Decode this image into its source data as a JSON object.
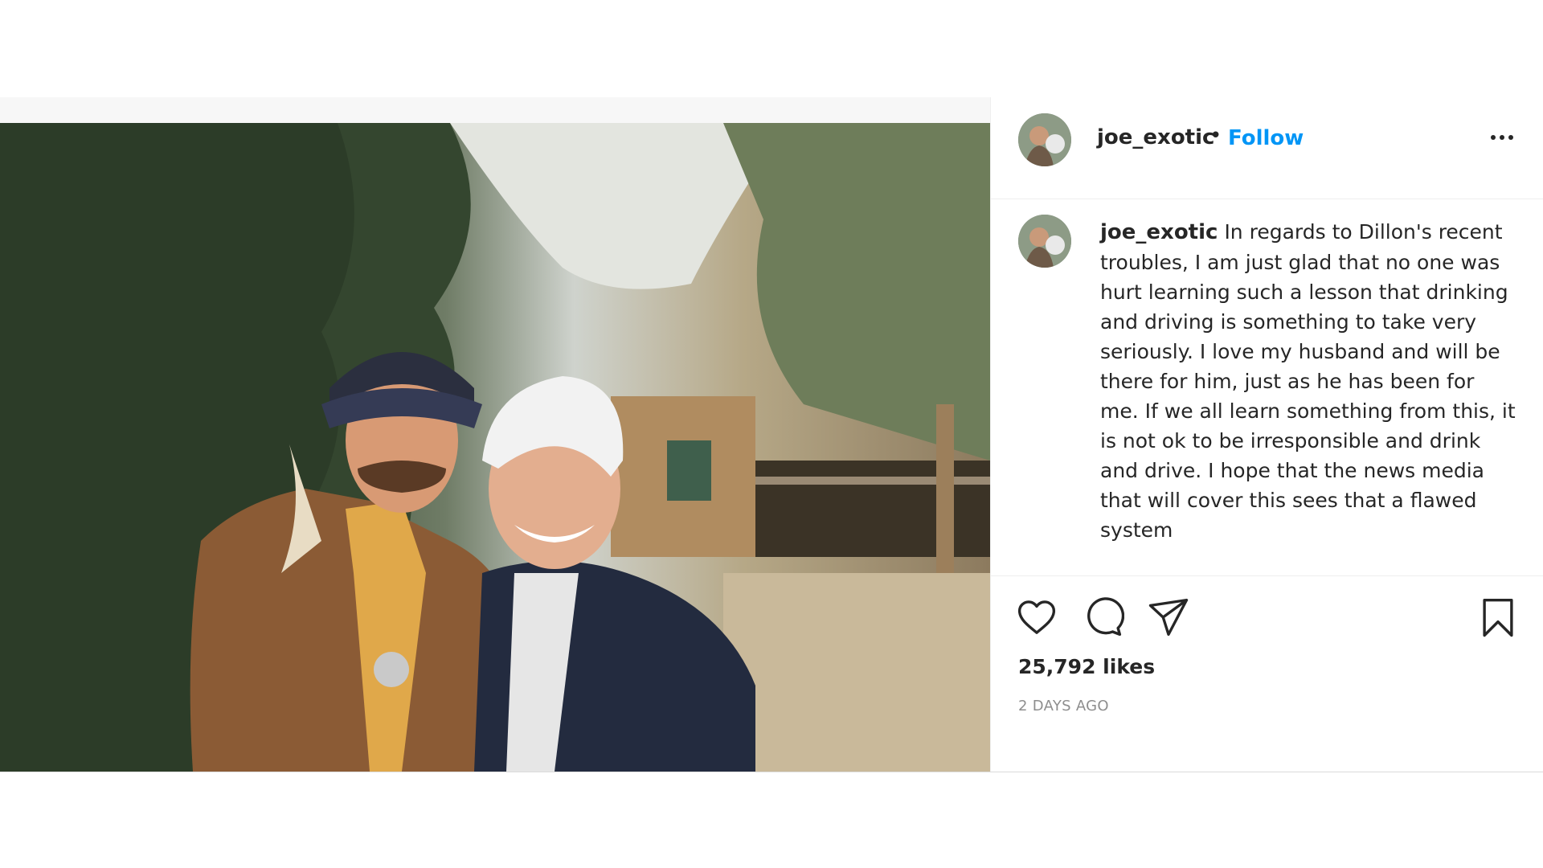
{
  "post": {
    "author": "joe_exotic",
    "follow_label": "Follow",
    "separator": "•",
    "caption_username": "joe_exotic",
    "caption_text": "In regards to Dillon's recent troubles, I am just glad that no one was hurt learning such a lesson that drinking and driving is something to take very seriously. I love my husband and will be there for him, just as he has been for me. If we all learn something from this, it is not ok to be irresponsible and drink and drive. I hope that the news media that will cover this sees that a flawed system",
    "likes": "25,792 likes",
    "timestamp": "2 DAYS AGO"
  },
  "icons": {
    "like": "heart-icon",
    "comment": "comment-icon",
    "share": "paper-plane-icon",
    "save": "bookmark-icon",
    "more": "more-options-icon"
  },
  "colors": {
    "follow": "#0095f6",
    "text": "#262626",
    "muted": "#8e8e8e"
  }
}
